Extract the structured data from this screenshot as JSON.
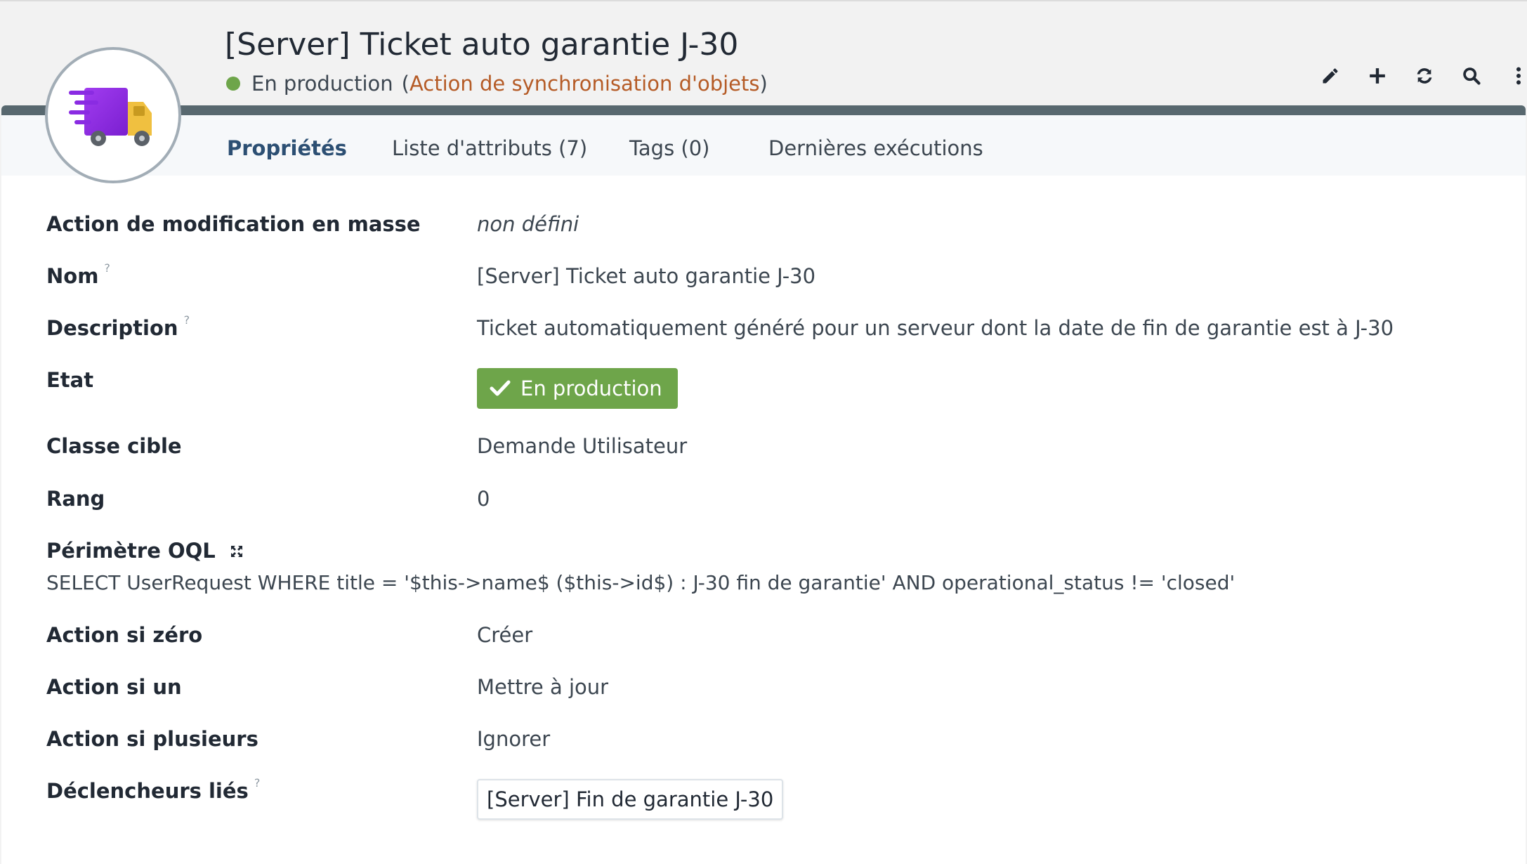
{
  "header": {
    "title": "[Server] Ticket auto garantie J-30",
    "status": "En production",
    "open_paren": "(",
    "class_link": "Action de synchronisation d'objets",
    "close_paren": ")"
  },
  "actions": [
    "pencil-icon",
    "plus-icon",
    "refresh-icon",
    "search-icon",
    "more-vertical-icon"
  ],
  "tabs": [
    {
      "label": "Propriétés"
    },
    {
      "label": "Liste d'attributs (7)"
    },
    {
      "label": "Tags (0)"
    },
    {
      "label": "Dernières exécutions"
    }
  ],
  "properties": {
    "mass_action": {
      "label": "Action de modification en masse",
      "value": "non défini"
    },
    "name": {
      "label": "Nom",
      "help": "?",
      "value": "[Server] Ticket auto garantie J-30"
    },
    "description": {
      "label": "Description",
      "help": "?",
      "value": "Ticket automatiquement généré pour un serveur dont la date de fin de garantie est à J-30"
    },
    "state": {
      "label": "Etat",
      "value": "En production"
    },
    "target_class": {
      "label": "Classe cible",
      "value": "Demande Utilisateur"
    },
    "rank": {
      "label": "Rang",
      "value": "0"
    },
    "oql": {
      "label": "Périmètre OQL",
      "value": "SELECT UserRequest WHERE title = '$this->name$ ($this->id$) : J-30 fin de garantie' AND operational_status != 'closed'"
    },
    "action_zero": {
      "label": "Action si zéro",
      "value": "Créer"
    },
    "action_one": {
      "label": "Action si un",
      "value": "Mettre à jour"
    },
    "action_many": {
      "label": "Action si plusieurs",
      "value": "Ignorer"
    },
    "triggers": {
      "label": "Déclencheurs liés",
      "help": "?",
      "value": "[Server] Fin de garantie J-30"
    }
  },
  "colors": {
    "status_green": "#6ea54a",
    "link_orange": "#b55b26",
    "header_bar": "#58686f",
    "active_tab": "#2c4f73"
  }
}
